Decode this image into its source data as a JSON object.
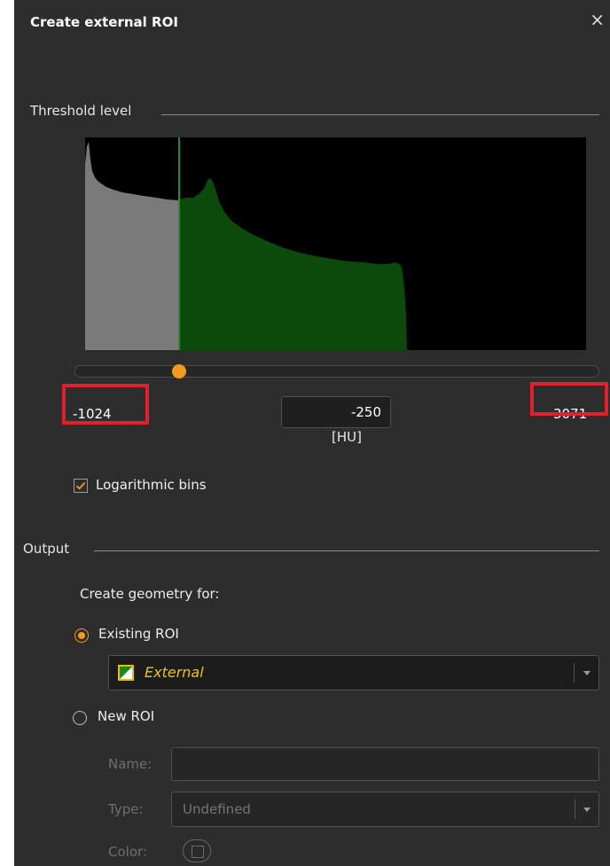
{
  "dialog": {
    "title": "Create external ROI",
    "close_symbol": "×"
  },
  "threshold": {
    "section_label": "Threshold level",
    "histogram": {
      "range_min": -1024,
      "range_max": 3071,
      "threshold_value": -250,
      "below_color": "#7a7a7a",
      "above_color": "#0c4a0c",
      "background_color": "#000000"
    },
    "slider_value": -250,
    "min_label": "-1024",
    "max_label": "3071",
    "value_input": "-250",
    "unit": "[HU]",
    "log_bins_label": "Logarithmic bins",
    "log_bins_checked": true,
    "highlight_color": "#e0202a",
    "accent_color": "#f39a1e"
  },
  "output": {
    "section_label": "Output",
    "create_geometry_label": "Create geometry for:",
    "existing_roi_label": "Existing ROI",
    "existing_roi_selected": true,
    "existing_roi_value": "External",
    "roi_color": "#f0c400",
    "new_roi_label": "New ROI",
    "new_roi_selected": false,
    "name_label": "Name:",
    "name_value": "",
    "type_label": "Type:",
    "type_value": "Undefined",
    "color_label": "Color:"
  }
}
